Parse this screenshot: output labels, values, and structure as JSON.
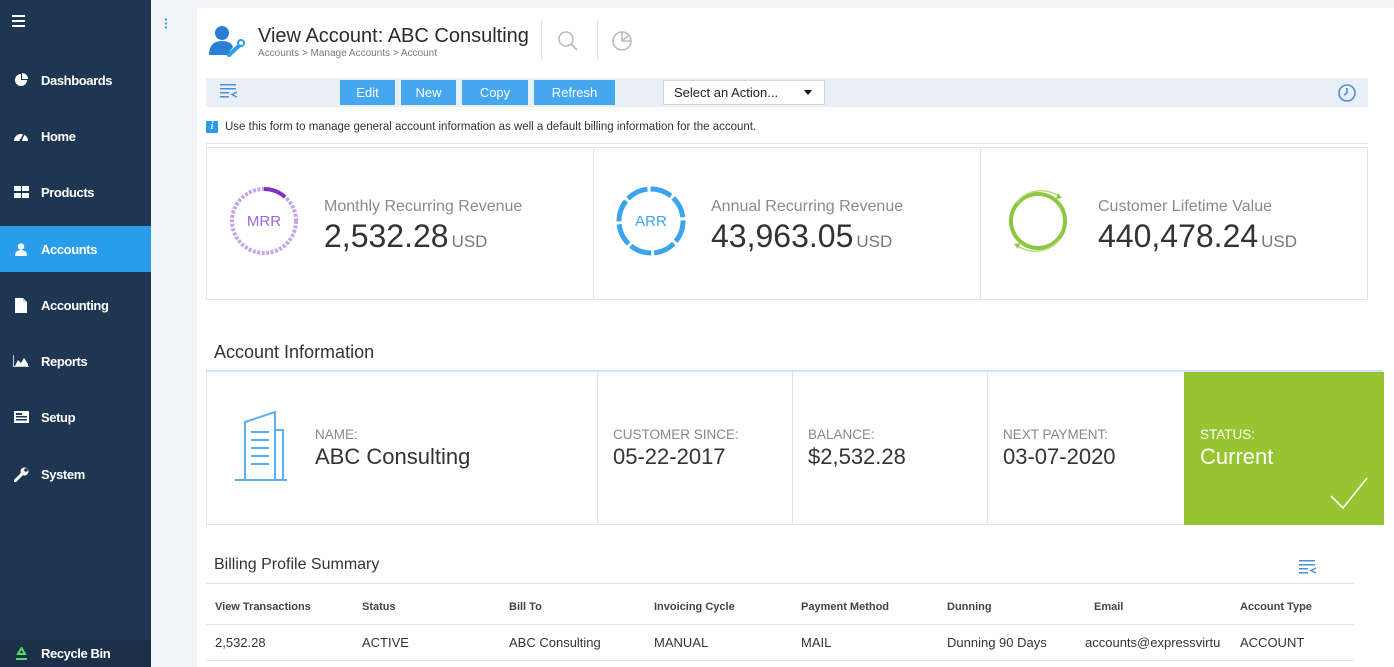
{
  "sidebar": {
    "items": [
      {
        "label": "Dashboards",
        "icon": "pie-chart-icon"
      },
      {
        "label": "Home",
        "icon": "gauge-icon"
      },
      {
        "label": "Products",
        "icon": "grid-icon"
      },
      {
        "label": "Accounts",
        "icon": "user-icon",
        "active": true
      },
      {
        "label": "Accounting",
        "icon": "document-icon"
      },
      {
        "label": "Reports",
        "icon": "area-chart-icon"
      },
      {
        "label": "Setup",
        "icon": "setup-icon"
      },
      {
        "label": "System",
        "icon": "wrench-icon"
      }
    ],
    "recycle_label": "Recycle Bin"
  },
  "header": {
    "title": "View Account: ABC Consulting",
    "breadcrumb": "Accounts > Manage Accounts > Account"
  },
  "toolbar": {
    "edit_label": "Edit",
    "new_label": "New",
    "copy_label": "Copy",
    "refresh_label": "Refresh",
    "action_select": "Select an Action..."
  },
  "info_text": "Use this form to manage general account information as well a default billing information for the account.",
  "metrics": [
    {
      "abbr": "MRR",
      "label": "Monthly Recurring Revenue",
      "value": "2,532.28",
      "unit": "USD",
      "color": "#b98ee3"
    },
    {
      "abbr": "ARR",
      "label": "Annual Recurring Revenue",
      "value": "43,963.05",
      "unit": "USD",
      "color": "#3aa5ee"
    },
    {
      "abbr": "",
      "label": "Customer Lifetime Value",
      "value": "440,478.24",
      "unit": "USD",
      "color": "#8dc63f"
    }
  ],
  "account_info": {
    "section_title": "Account Information",
    "name_label": "NAME:",
    "name_value": "ABC Consulting",
    "since_label": "CUSTOMER SINCE:",
    "since_value": "05-22-2017",
    "balance_label": "BALANCE:",
    "balance_value": "$2,532.28",
    "next_label": "NEXT PAYMENT:",
    "next_value": "03-07-2020",
    "status_label": "STATUS:",
    "status_value": "Current",
    "status_color": "#97c531"
  },
  "billing": {
    "section_title": "Billing Profile Summary",
    "columns": [
      "View Transactions",
      "Status",
      "Bill To",
      "Invoicing Cycle",
      "Payment Method",
      "Dunning",
      "Email",
      "Account Type"
    ],
    "rows": [
      [
        "2,532.28",
        "ACTIVE",
        "ABC Consulting",
        "MANUAL",
        "MAIL",
        "Dunning 90 Days",
        "accounts@expressvirtu",
        "ACCOUNT"
      ]
    ]
  }
}
